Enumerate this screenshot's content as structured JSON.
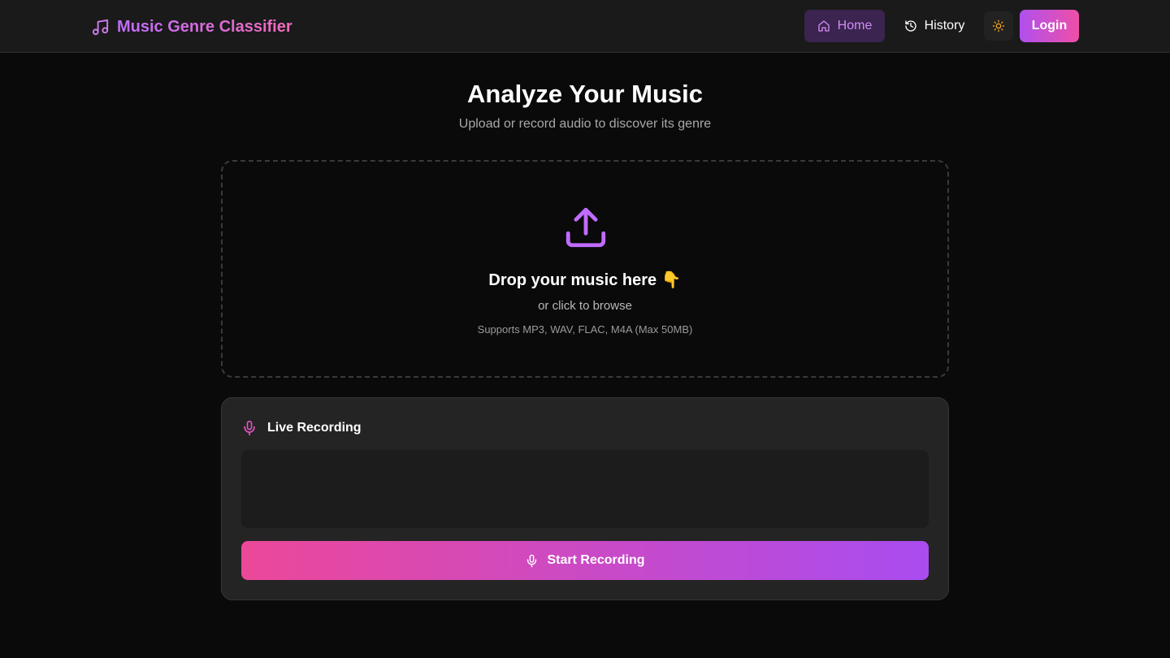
{
  "header": {
    "brand": "Music Genre Classifier",
    "nav": {
      "home_label": "Home",
      "history_label": "History"
    },
    "login_label": "Login",
    "icons": {
      "brand": "music-note-icon",
      "home": "home-icon",
      "history": "history-icon",
      "theme": "sun-icon"
    }
  },
  "hero": {
    "title": "Analyze Your Music",
    "subtitle": "Upload or record audio to discover its genre"
  },
  "upload": {
    "title": "Drop your music here",
    "title_emoji": "👇",
    "subtitle": "or click to browse",
    "formats": "Supports MP3, WAV, FLAC, M4A (Max 50MB)",
    "icon": "upload-icon"
  },
  "recording": {
    "title": "Live Recording",
    "button_label": "Start Recording",
    "icon": "microphone-icon"
  },
  "colors": {
    "background": "#0a0a0a",
    "navbar": "#1a1a1a",
    "accent_purple": "#c06cff",
    "accent_pink": "#ec4899",
    "home_active_bg": "#3b2450",
    "theme_icon": "#f5a623",
    "card_bg": "#242424"
  }
}
